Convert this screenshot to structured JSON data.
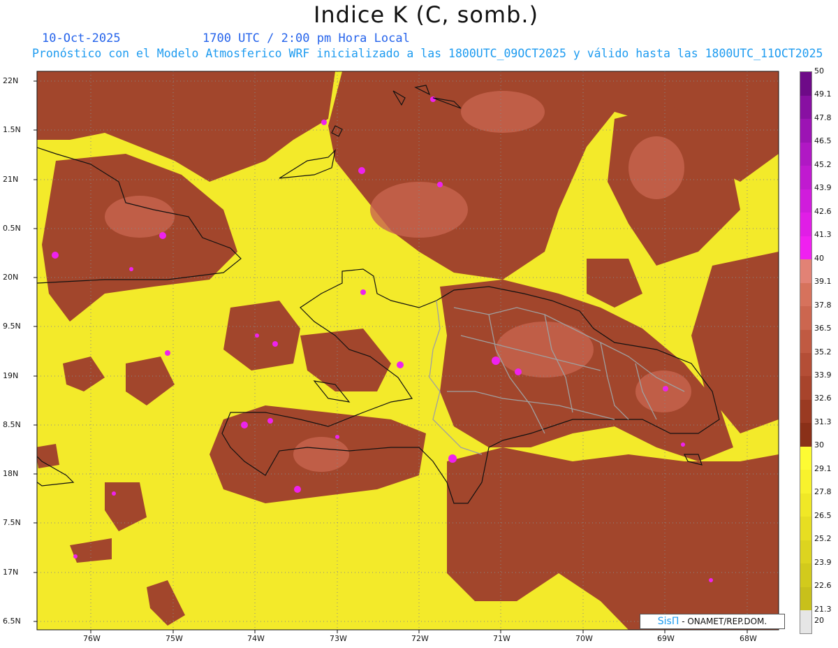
{
  "title": "Indice K (C, somb.)",
  "date": "10-Oct-2025",
  "time": "1700 UTC / 2:00 pm Hora Local",
  "subtitle": "Pronóstico con el Modelo Atmosferico WRF inicializado a las 1800UTC_09OCT2025 y válido hasta las  1800UTC_11OCT2025",
  "credit_logo": "SisΠ",
  "credit_org": "- ONAMET/REP.DOM.",
  "lat_labels": [
    "22N",
    "1.5N",
    "21N",
    "0.5N",
    "20N",
    "9.5N",
    "19N",
    "8.5N",
    "18N",
    "7.5N",
    "17N",
    "6.5N"
  ],
  "lon_labels": [
    "76W",
    "75W",
    "74W",
    "73W",
    "72W",
    "71W",
    "70W",
    "69W",
    "68W"
  ],
  "legend": {
    "levels": [
      "20",
      "21.3",
      "22.6",
      "23.9",
      "25.2",
      "26.5",
      "27.8",
      "29.1",
      "30",
      "31.3",
      "32.6",
      "33.9",
      "35.2",
      "36.5",
      "37.8",
      "39.1",
      "40",
      "41.3",
      "42.6",
      "43.9",
      "45.2",
      "46.5",
      "47.8",
      "49.1",
      "50"
    ],
    "colors": [
      "#e6e6e6",
      "#c8c01b",
      "#d2ca1c",
      "#ddd41f",
      "#e7de22",
      "#f0e826",
      "#f8f22d",
      "#fdfb33",
      "#8a3018",
      "#9a3a22",
      "#a8442c",
      "#b44e36",
      "#c05a42",
      "#cc664f",
      "#d6725c",
      "#e28275",
      "#f020f0",
      "#e01ee6",
      "#d01cdc",
      "#c01ad0",
      "#b018c4",
      "#9c14b4",
      "#8810a2",
      "#6e0a88"
    ]
  }
}
